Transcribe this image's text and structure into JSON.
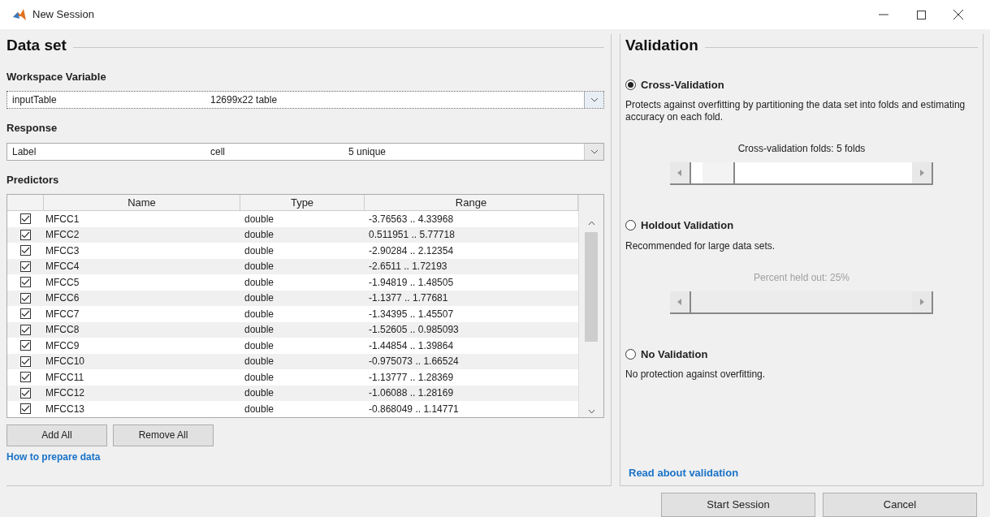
{
  "window": {
    "title": "New Session"
  },
  "data_set": {
    "title": "Data set",
    "workspace_variable": {
      "label": "Workspace Variable",
      "name": "inputTable",
      "info": "12699x22 table"
    },
    "response": {
      "label": "Response",
      "name": "Label",
      "type": "cell",
      "info": "5 unique"
    },
    "predictors": {
      "label": "Predictors",
      "columns": [
        "Name",
        "Type",
        "Range"
      ],
      "rows": [
        {
          "checked": true,
          "name": "MFCC1",
          "type": "double",
          "range": "-3.76563 .. 4.33968"
        },
        {
          "checked": true,
          "name": "MFCC2",
          "type": "double",
          "range": "0.511951 .. 5.77718"
        },
        {
          "checked": true,
          "name": "MFCC3",
          "type": "double",
          "range": "-2.90284 .. 2.12354"
        },
        {
          "checked": true,
          "name": "MFCC4",
          "type": "double",
          "range": "-2.6511 .. 1.72193"
        },
        {
          "checked": true,
          "name": "MFCC5",
          "type": "double",
          "range": "-1.94819 .. 1.48505"
        },
        {
          "checked": true,
          "name": "MFCC6",
          "type": "double",
          "range": "-1.1377 .. 1.77681"
        },
        {
          "checked": true,
          "name": "MFCC7",
          "type": "double",
          "range": "-1.34395 .. 1.45507"
        },
        {
          "checked": true,
          "name": "MFCC8",
          "type": "double",
          "range": "-1.52605 .. 0.985093"
        },
        {
          "checked": true,
          "name": "MFCC9",
          "type": "double",
          "range": "-1.44854 .. 1.39864"
        },
        {
          "checked": true,
          "name": "MFCC10",
          "type": "double",
          "range": "-0.975073 .. 1.66524"
        },
        {
          "checked": true,
          "name": "MFCC11",
          "type": "double",
          "range": "-1.13777 .. 1.28369"
        },
        {
          "checked": true,
          "name": "MFCC12",
          "type": "double",
          "range": "-1.06088 .. 1.28169"
        },
        {
          "checked": true,
          "name": "MFCC13",
          "type": "double",
          "range": "-0.868049 .. 1.14771"
        }
      ]
    },
    "buttons": [
      "Add All",
      "Remove All"
    ],
    "link": "How to prepare data"
  },
  "validation": {
    "title": "Validation",
    "options": [
      {
        "label": "Cross-Validation",
        "selected": true,
        "description": "Protects against overfitting by partitioning the data set into folds and estimating accuracy on each fold.",
        "slider": {
          "caption": "Cross-validation folds: 5 folds",
          "disabled": false,
          "level": 0.06
        }
      },
      {
        "label": "Holdout Validation",
        "selected": false,
        "description": "Recommended for large data sets.",
        "slider": {
          "caption": "Percent held out: 25%",
          "disabled": true
        }
      },
      {
        "label": "No Validation",
        "selected": false,
        "description": "No protection against overfitting."
      }
    ],
    "link": "Read about validation"
  },
  "buttons": [
    "Start Session",
    "Cancel"
  ]
}
